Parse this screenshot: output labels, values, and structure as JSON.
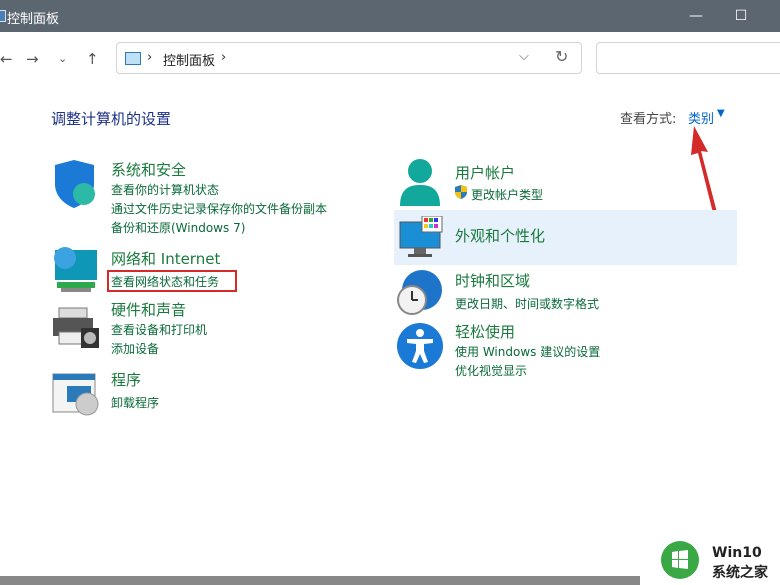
{
  "window": {
    "title": "控制面板"
  },
  "address": {
    "crumb": "控制面板"
  },
  "page": {
    "heading": "调整计算机的设置",
    "view_by_label": "查看方式:",
    "view_by_value": "类别"
  },
  "categories": [
    {
      "title": "系统和安全",
      "links": [
        "查看你的计算机状态",
        "通过文件历史记录保存你的文件备份副本",
        "备份和还原(Windows 7)"
      ]
    },
    {
      "title": "网络和 Internet",
      "links": [
        "查看网络状态和任务"
      ]
    },
    {
      "title": "硬件和声音",
      "links": [
        "查看设备和打印机",
        "添加设备"
      ]
    },
    {
      "title": "程序",
      "links": [
        "卸载程序"
      ]
    },
    {
      "title": "用户帐户",
      "links": [
        "更改帐户类型"
      ]
    },
    {
      "title": "外观和个性化",
      "links": []
    },
    {
      "title": "时钟和区域",
      "links": [
        "更改日期、时间或数字格式"
      ]
    },
    {
      "title": "轻松使用",
      "links": [
        "使用 Windows 建议的设置",
        "优化视觉显示"
      ]
    }
  ],
  "watermark": {
    "line1": "Win10",
    "line2": "系统之家"
  },
  "colors": {
    "accent": "#0066cc",
    "category_title": "#1a7a3d",
    "titlebar": "#5c6670",
    "annotation": "#d42a2a"
  }
}
